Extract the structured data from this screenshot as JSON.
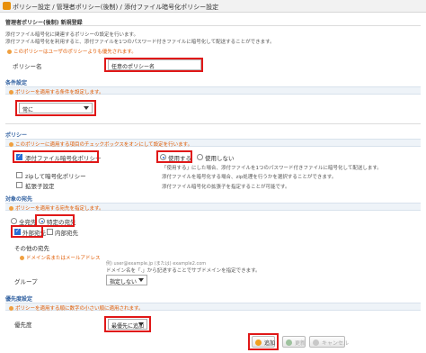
{
  "window": {
    "title": "ポリシー設定 / 管理者ポリシー(後制) / 添付ファイル暗号化ポリシー設定"
  },
  "page": {
    "heading": "管理者ポリシー(後制) 新規登録",
    "description_line1": "添付ファイル暗号化に関連するポリシーの設定を行います。",
    "description_line2": "添付ファイル暗号化を利用すると、添付ファイルを1つのパスワード付きファイルに暗号化して配送することができます。",
    "note": "このポリシーはユーザのポリシーよりも優先されます。"
  },
  "policy_name": {
    "label": "ポリシー名",
    "value": "任意のポリシー名"
  },
  "condition": {
    "section_title": "条件設定",
    "note": "ポリシーを適用する条件を設定します。",
    "select_value": "常に"
  },
  "policy": {
    "section_title": "ポリシー",
    "note": "このポリシーに適用する項目のチェックボックスをオンにして設定を行います。",
    "attach_label": "添付ファイル暗号化ポリシー",
    "use_label": "使用する",
    "not_use_label": "使用しない",
    "use_desc": "「使用する」にした場合、添付ファイルを1つのパスワード付きファイルに暗号化して配送します。",
    "zip_label": "zipして暗号化ポリシー",
    "zip_desc": "添付ファイルを暗号化する場合、zip処理を行うかを選択することができます。",
    "ext_label": "拡張子設定",
    "ext_desc": "添付ファイル暗号化の拡張子を指定することが可能です。"
  },
  "target": {
    "section_title": "対象の宛先",
    "note": "ポリシーを適用する宛先を指定します。",
    "all_label": "全宛先",
    "specific_label": "特定の宛先",
    "internal_label": "外部宛先",
    "external_label": "内部宛先",
    "other_label": "その他の宛先",
    "domain_note": "ドメイン名またはメールアドレス",
    "domain_example": "例) user@example.jp (または) example2.com",
    "sub_note": "ドメイン名を「.」から記述することでサブドメインを指定できます。",
    "group_label": "グループ",
    "group_value": "指定しない"
  },
  "priority": {
    "section_title": "優先度設定",
    "note": "ポリシーを適用する順に数字の小さい順に適用されます。",
    "label": "優先度",
    "value": "最優先に追加"
  },
  "actions": {
    "add_label": "追加",
    "update_label": "更新",
    "cancel_label": "キャンセル"
  },
  "colors": {
    "accent": "#e01818",
    "link": "#3060a0",
    "note": "#e05a00"
  }
}
